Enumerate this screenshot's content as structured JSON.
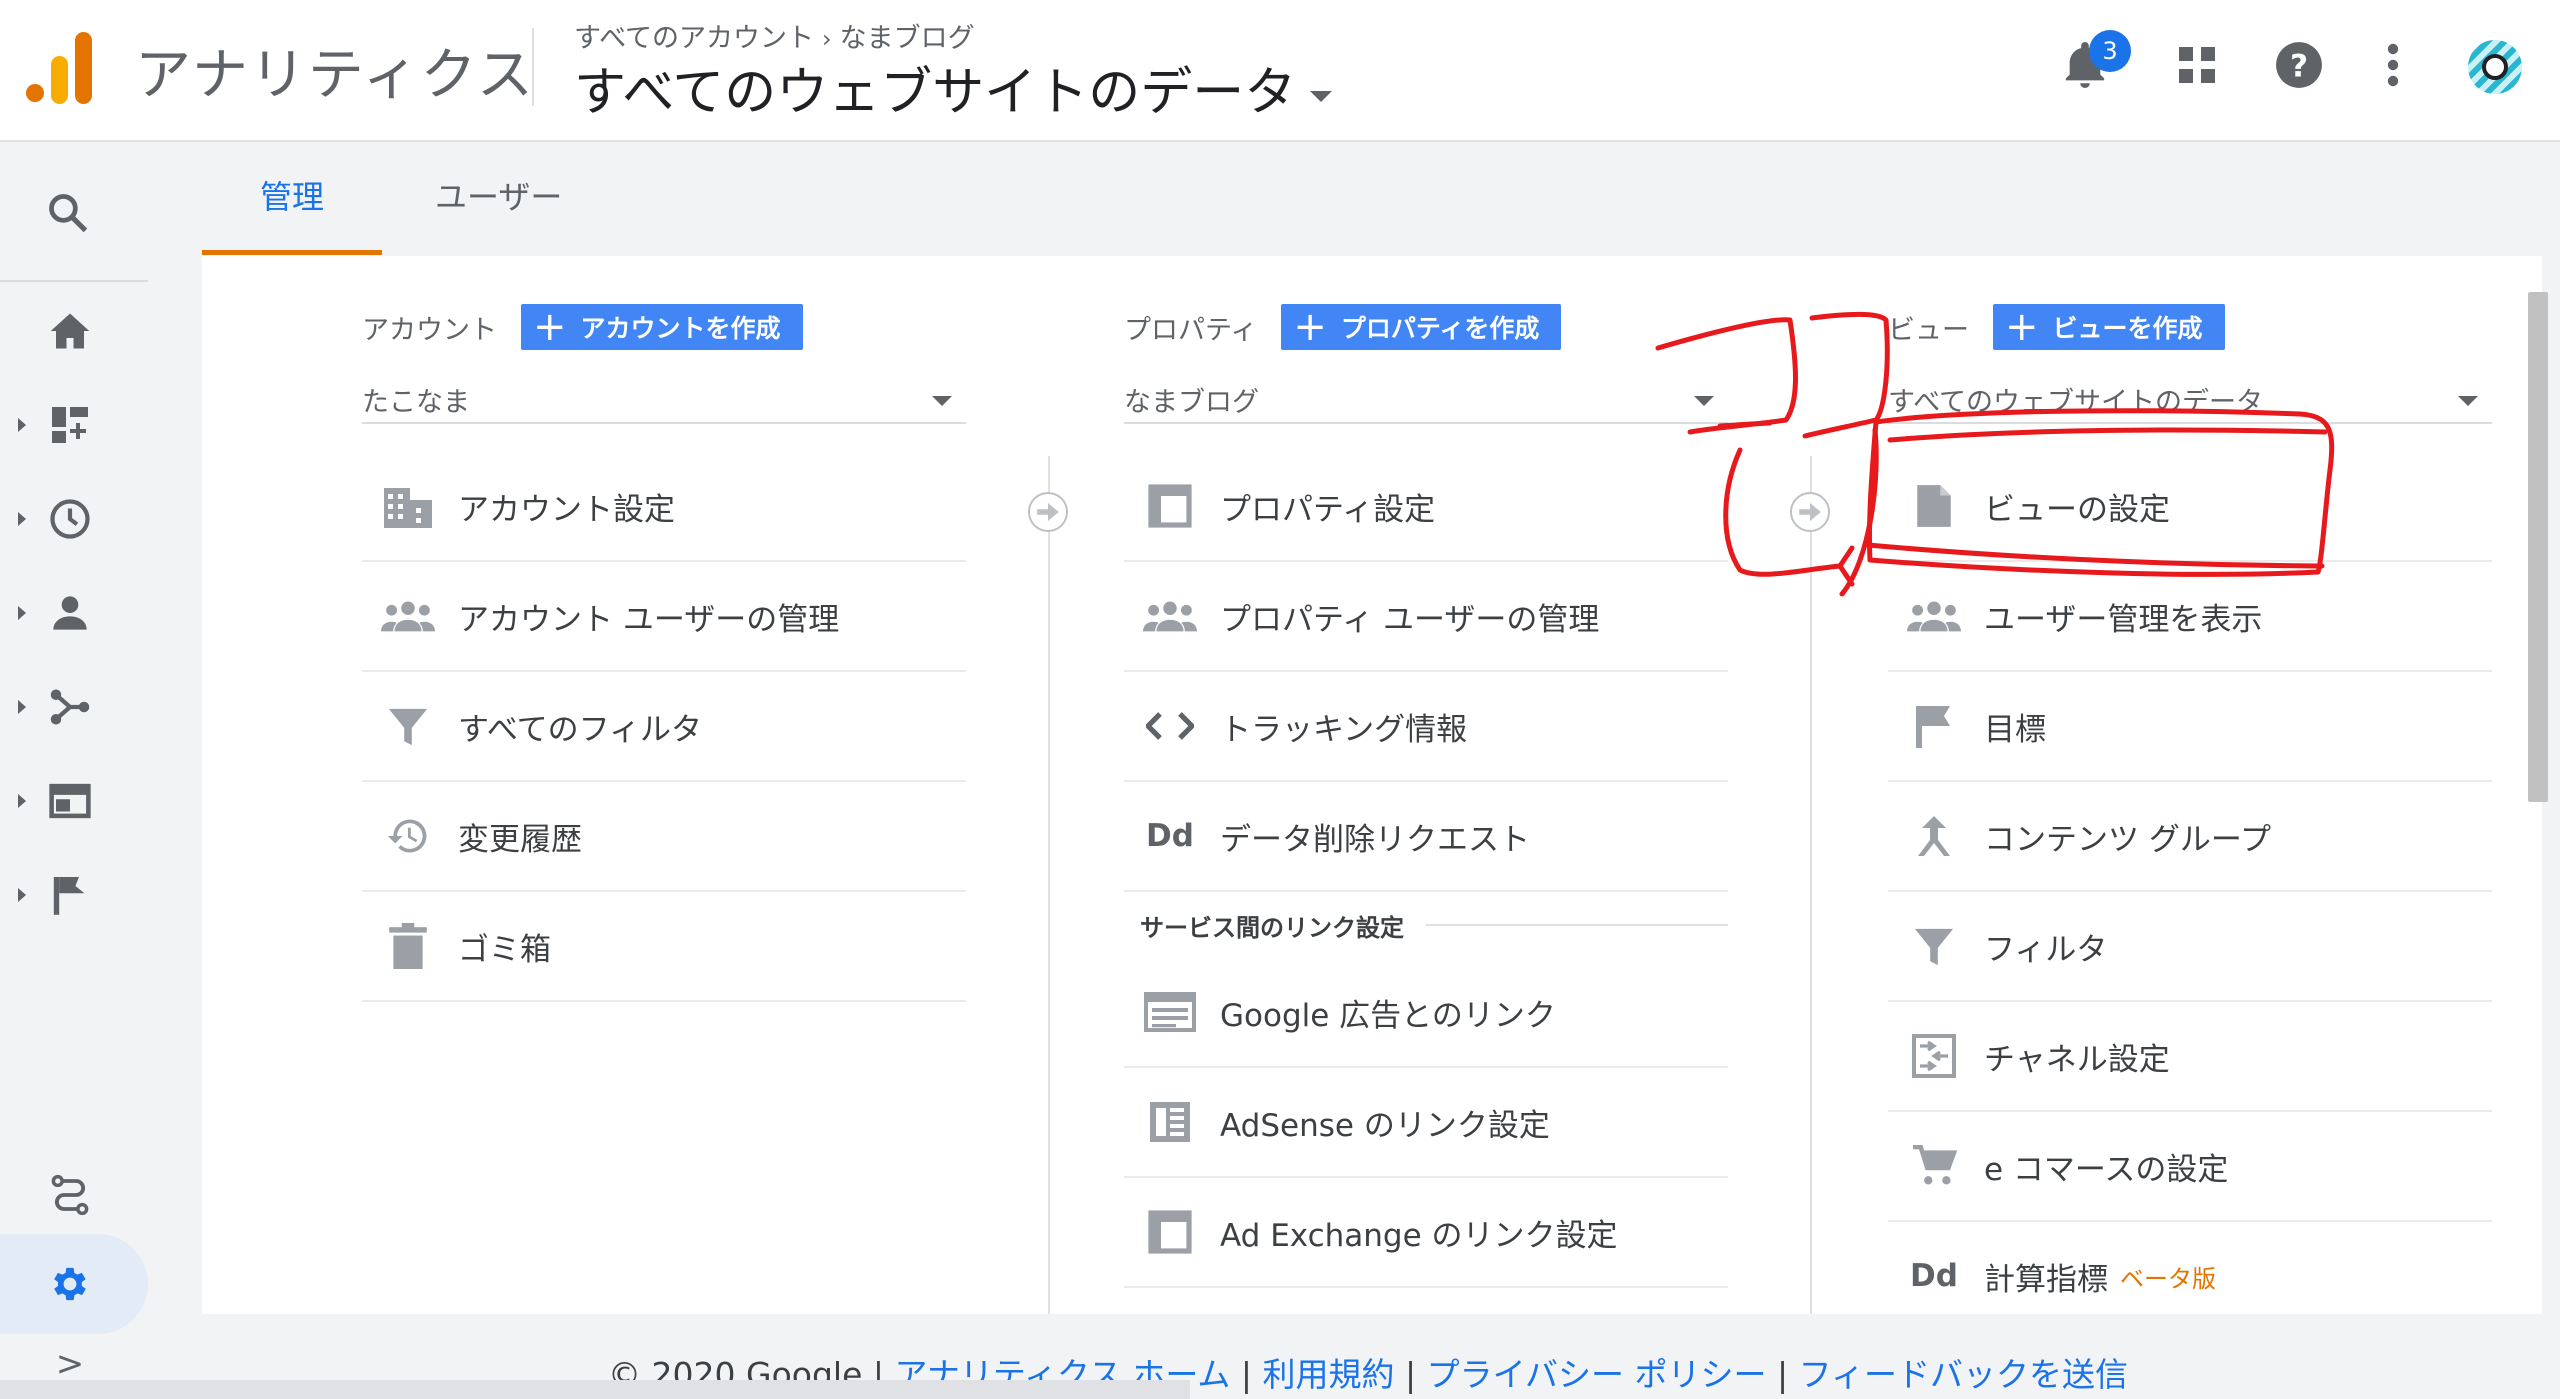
{
  "header": {
    "app_title": "アナリティクス",
    "breadcrumb_root": "すべてのアカウント",
    "breadcrumb_separator": "›",
    "breadcrumb_property": "なまブログ",
    "view_title": "すべてのウェブサイトのデータ",
    "notification_count": "3",
    "icons": [
      "bell-icon",
      "apps-grid-icon",
      "help-icon",
      "more-vert-icon",
      "avatar"
    ]
  },
  "leftnav": {
    "icons": [
      "search-icon",
      "home-icon",
      "customization-icon",
      "realtime-icon",
      "audience-icon",
      "acquisition-icon",
      "behavior-icon",
      "conversions-icon",
      "attribution-icon",
      "discover-icon",
      "admin-gear-icon",
      "expand-icon"
    ],
    "expand_symbol": ">"
  },
  "tabs": {
    "admin": "管理",
    "user": "ユーザー"
  },
  "account": {
    "label": "アカウント",
    "create_button": "アカウントを作成",
    "selected": "たこなま",
    "items": [
      {
        "label": "アカウント設定",
        "icon": "building-icon"
      },
      {
        "label": "アカウント ユーザーの管理",
        "icon": "people-icon"
      },
      {
        "label": "すべてのフィルタ",
        "icon": "filter-icon"
      },
      {
        "label": "変更履歴",
        "icon": "history-icon"
      },
      {
        "label": "ゴミ箱",
        "icon": "trash-icon"
      }
    ]
  },
  "property": {
    "label": "プロパティ",
    "create_button": "プロパティを作成",
    "selected": "なまブログ",
    "items": [
      {
        "label": "プロパティ設定",
        "icon": "layout-icon"
      },
      {
        "label": "プロパティ ユーザーの管理",
        "icon": "people-icon"
      },
      {
        "label": "トラッキング情報",
        "icon": "code-icon"
      },
      {
        "label": "データ削除リクエスト",
        "icon": "dd-icon",
        "icon_text": "Dd"
      }
    ],
    "link_section_title": "サービス間のリンク設定",
    "link_items": [
      {
        "label": "Google 広告とのリンク",
        "icon": "ads-icon"
      },
      {
        "label": "AdSense のリンク設定",
        "icon": "adsense-icon"
      },
      {
        "label": "Ad Exchange のリンク設定",
        "icon": "layout-icon"
      }
    ]
  },
  "view": {
    "label": "ビュー",
    "create_button": "ビューを作成",
    "selected": "すべてのウェブサイトのデータ",
    "items": [
      {
        "label": "ビューの設定",
        "icon": "document-icon"
      },
      {
        "label": "ユーザー管理を表示",
        "icon": "people-icon"
      },
      {
        "label": "目標",
        "icon": "flag-icon"
      },
      {
        "label": "コンテンツ グループ",
        "icon": "content-group-icon"
      },
      {
        "label": "フィルタ",
        "icon": "filter-icon"
      },
      {
        "label": "チャネル設定",
        "icon": "channel-icon"
      },
      {
        "label": "e コマースの設定",
        "icon": "cart-icon"
      },
      {
        "label": "計算指標",
        "icon": "dd-icon",
        "icon_text": "Dd",
        "badge": "ベータ版"
      }
    ]
  },
  "footer": {
    "copyright": "© 2020 Google",
    "separator": "|",
    "links": [
      "アナリティクス ホーム",
      "利用規約",
      "プライバシー ポリシー",
      "フィードバックを送信"
    ]
  },
  "annotation": {
    "text": "ココ",
    "color": "#e8191c"
  },
  "colors": {
    "accent_blue": "#1a73e8",
    "button_blue": "#4285f4",
    "tab_underline_orange": "#e37400"
  }
}
